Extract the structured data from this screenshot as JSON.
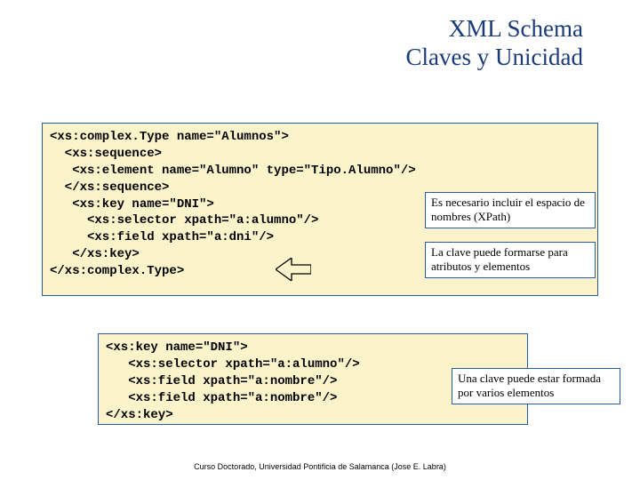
{
  "title": {
    "line1": "XML Schema",
    "line2": "Claves y Unicidad"
  },
  "code1": "<xs:complex.Type name=\"Alumnos\">\n  <xs:sequence>\n   <xs:element name=\"Alumno\" type=\"Tipo.Alumno\"/>\n  </xs:sequence>\n   <xs:key name=\"DNI\">\n     <xs:selector xpath=\"a:alumno\"/>\n     <xs:field xpath=\"a:dni\"/>\n   </xs:key>\n</xs:complex.Type>",
  "code2": "<xs:key name=\"DNI\">\n   <xs:selector xpath=\"a:alumno\"/>\n   <xs:field xpath=\"a:nombre\"/>\n   <xs:field xpath=\"a:nombre\"/>\n</xs:key>",
  "notes": {
    "n1": "Es necesario incluir el espacio de nombres (XPath)",
    "n2": "La clave puede formarse para atributos y elementos",
    "n3": "Una clave puede estar formada por varios elementos"
  },
  "footer": "Curso Doctorado, Universidad Pontificia de Salamanca (Jose E. Labra)"
}
